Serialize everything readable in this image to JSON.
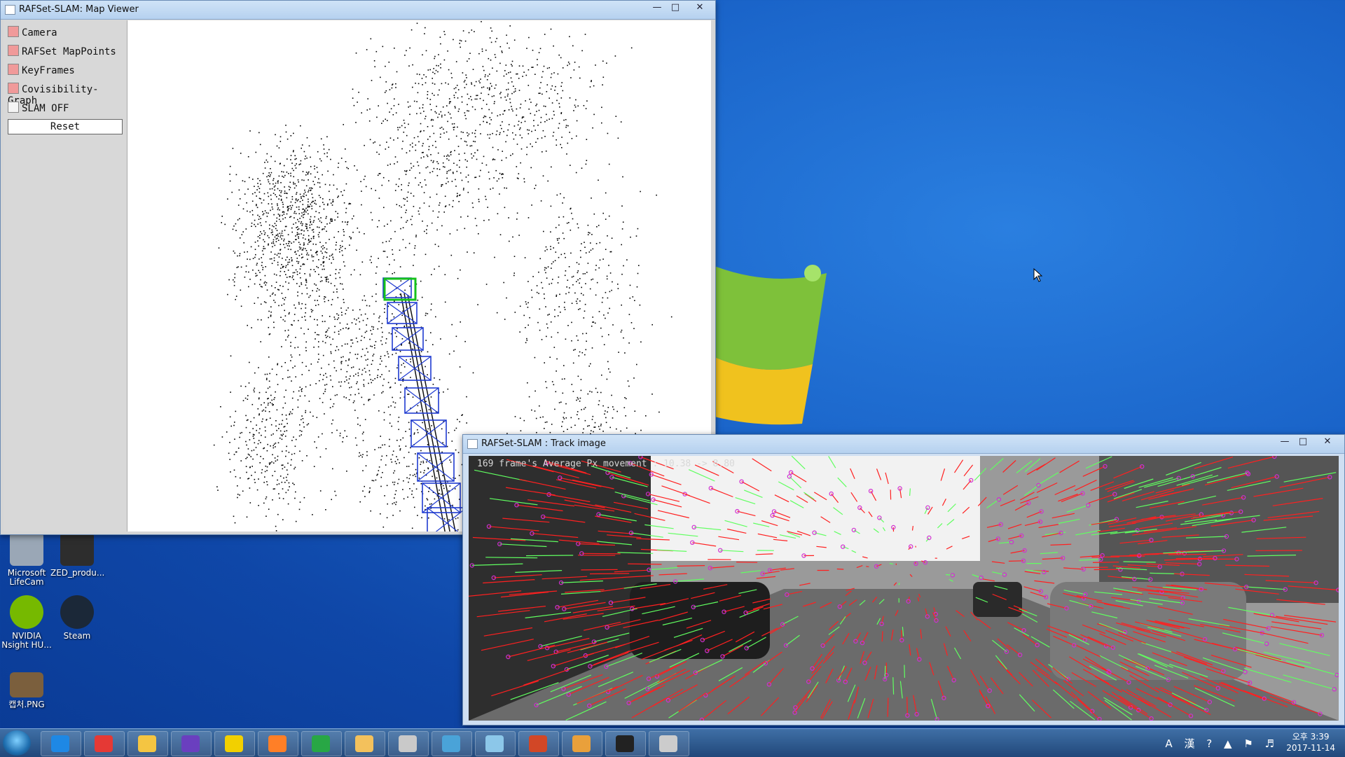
{
  "map_window": {
    "title": "RAFSet-SLAM: Map Viewer",
    "panel": [
      {
        "label": "Camera",
        "checked": true
      },
      {
        "label": "RAFSet MapPoints",
        "checked": true
      },
      {
        "label": "KeyFrames",
        "checked": true
      },
      {
        "label": "Covisibility-Graph",
        "checked": true
      },
      {
        "label": "SLAM OFF",
        "checked": false
      }
    ],
    "reset_label": "Reset"
  },
  "track_window": {
    "title": "RAFSet-SLAM : Track image",
    "overlay": "169 frame's Average Px movement : 10.38 -> 8.80"
  },
  "desktop": {
    "icons": [
      {
        "label": "Microsoft LifeCam"
      },
      {
        "label": "ZED_produ..."
      },
      {
        "label": "NVIDIA Nsight HU..."
      },
      {
        "label": "Steam"
      },
      {
        "label": "캡처.PNG"
      }
    ]
  },
  "taskbar": {
    "apps": [
      "internet-explorer",
      "chrome",
      "file-explorer",
      "visual-studio",
      "kakaotalk",
      "matlab",
      "app-green",
      "folder",
      "snipping-tool",
      "control-panel",
      "notepad",
      "powerpoint",
      "paint",
      "cmd",
      "app-window"
    ],
    "tray_text": "A 漢",
    "clock_time": "오후 3:39",
    "clock_date": "2017-11-14"
  },
  "colors": {
    "accent": "#1a64c9",
    "keyframe": "#1f3bd1",
    "current_camera": "#16c21b",
    "flow_red": "#ff2020",
    "flow_green": "#60ff60",
    "flow_magenta": "#d030d0"
  }
}
